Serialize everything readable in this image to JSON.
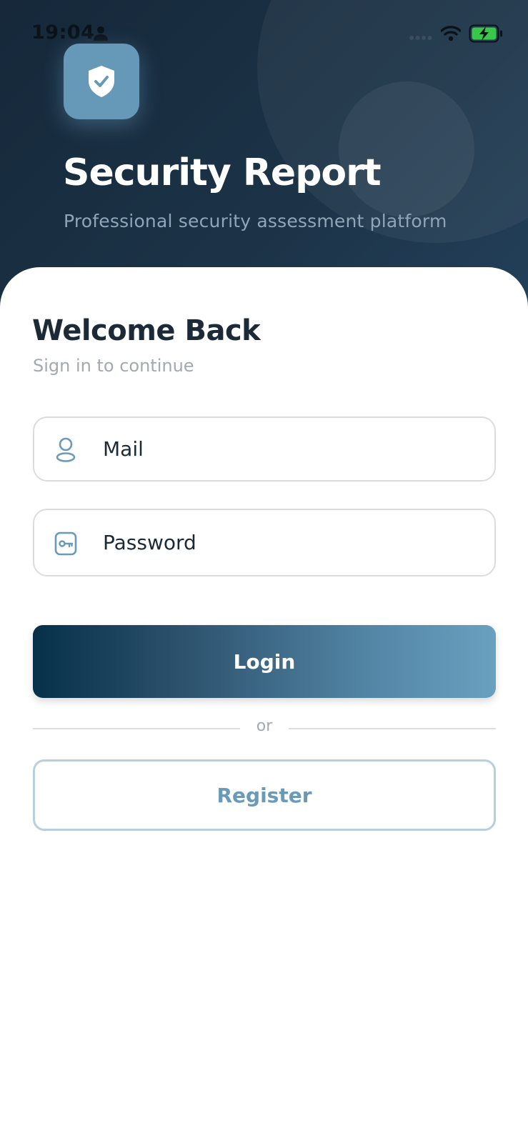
{
  "status_bar": {
    "time": "19:04",
    "icons": [
      "person-icon",
      "signal-icon",
      "wifi-icon",
      "battery-charging-icon"
    ]
  },
  "header": {
    "logo_icon": "shield-check-icon",
    "title": "Security Report",
    "subtitle": "Professional security assessment platform"
  },
  "login_card": {
    "heading": "Welcome Back",
    "subheading": "Sign in to continue",
    "mail_field": {
      "icon": "user-icon",
      "placeholder": "Mail",
      "value": ""
    },
    "password_field": {
      "icon": "key-icon",
      "placeholder": "Password",
      "value": ""
    },
    "login_label": "Login",
    "divider_text": "or",
    "register_label": "Register"
  },
  "colors": {
    "header_bg": "#16283a",
    "accent": "#6698b8",
    "login_gradient_start": "#06304a",
    "login_gradient_end": "#6aa0bf",
    "register_text": "#6a9ab8",
    "battery_green": "#3ac84a"
  }
}
